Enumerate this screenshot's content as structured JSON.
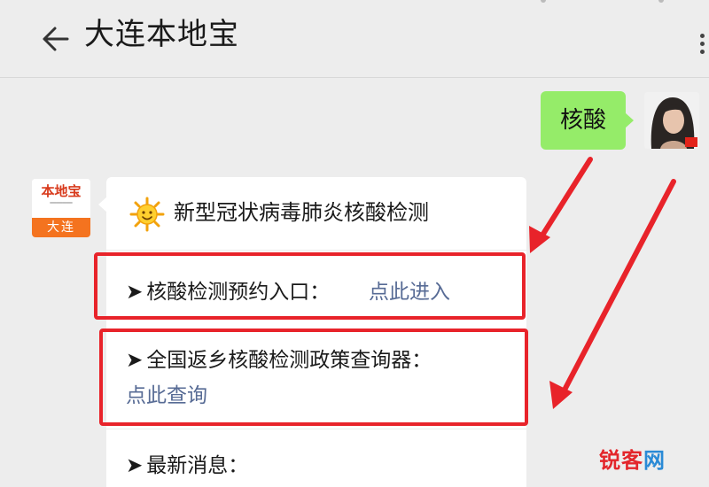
{
  "header": {
    "title": "大连本地宝",
    "back_icon": "arrow-left-icon",
    "more_icon": "vertical-ellipsis-icon"
  },
  "user_message": {
    "text": "核酸",
    "bubble_color": "#95ec69"
  },
  "bot": {
    "avatar_logo_text": "本地宝",
    "avatar_band_text": "大连",
    "accent_color": "#f4731f"
  },
  "bot_message": {
    "headline_icon": "sun-emoji-icon",
    "headline": "新型冠状病毒肺炎核酸检测",
    "items": [
      {
        "prefix": "➤",
        "label": "核酸检测预约入口：",
        "link": "点此进入"
      },
      {
        "prefix": "➤",
        "label": "全国返乡核酸检测政策查询器：",
        "link": "点此查询"
      },
      {
        "prefix": "➤",
        "label": "最新消息："
      }
    ],
    "link_color": "#576b95"
  },
  "annotations": {
    "highlight_color": "#e8232a"
  },
  "watermark": {
    "part_a": "锐客",
    "part_b": "网"
  }
}
